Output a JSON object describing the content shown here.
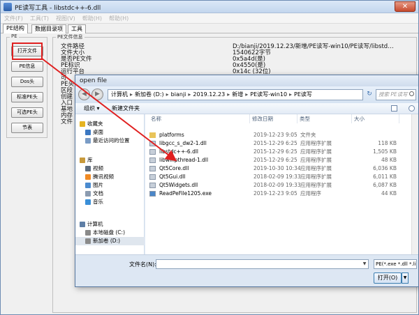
{
  "main_window": {
    "title": "PE读写工具 - libstdc++-6.dll",
    "close_glyph": "✕",
    "menu": [
      "文件(F)",
      "工具(T)",
      "视图(V)",
      "帮助(H)",
      "帮助(H)"
    ],
    "tabs": [
      "PE结构",
      "数据目录项",
      "工具"
    ],
    "pe_group_label": "PE",
    "info_group_label": "PE文件信息",
    "side_buttons": [
      "打开文件",
      "PE信息",
      "Dos头",
      "标准PE头",
      "可选PE头",
      "节表"
    ],
    "info_labels": [
      "文件路径",
      "文件大小",
      "是否PE文件",
      "PE标识",
      "运行平台",
      "可",
      "PE头",
      "区段",
      "创建",
      "入口",
      "基地",
      "内存",
      "文件"
    ],
    "info_values": [
      "D:/bianji/2019.12.23/新增/PE读写-win10/PE读写/libstd…",
      "1540622字节",
      "0x5a4d(是)",
      "0x4550(是)",
      "0x14c (32位)"
    ]
  },
  "dialog": {
    "title": "open file",
    "back_glyph": "◀",
    "forward_glyph": "▶",
    "breadcrumbs": [
      "计算机",
      "新加卷 (D:)",
      "bianji",
      "2019.12.23",
      "新增",
      "PE读写-win10",
      "PE读写"
    ],
    "refresh_glyph": "↻",
    "search_placeholder": "搜索 PE读写",
    "toolbar": {
      "organize": "组织 ▾",
      "new_folder": "新建文件夹"
    },
    "nav_items": [
      {
        "label": "收藏夹",
        "icon": "star-icon",
        "color": "#e6b422"
      },
      {
        "label": "桌面",
        "icon": "desktop-icon",
        "color": "#3b78c2"
      },
      {
        "label": "最近访问的位置",
        "icon": "recent-icon",
        "color": "#7a9cc6"
      },
      {
        "label": "库",
        "icon": "library-icon",
        "color": "#c89a3c"
      },
      {
        "label": "视频",
        "icon": "video-icon",
        "color": "#5c6c80"
      },
      {
        "label": "腾讯视频",
        "icon": "tencent-video-icon",
        "color": "#f08a24"
      },
      {
        "label": "图片",
        "icon": "picture-icon",
        "color": "#4b8bcf"
      },
      {
        "label": "文档",
        "icon": "document-icon",
        "color": "#8b9bb0"
      },
      {
        "label": "音乐",
        "icon": "music-icon",
        "color": "#3a8fd8"
      },
      {
        "label": "计算机",
        "icon": "computer-icon",
        "color": "#5f7fa6"
      },
      {
        "label": "本地磁盘 (C:)",
        "icon": "disk-icon",
        "color": "#8a8a8a"
      },
      {
        "label": "新加卷 (D:)",
        "icon": "disk-icon",
        "color": "#8a8a8a"
      }
    ],
    "columns": [
      "名称",
      "修改日期",
      "类型",
      "大小"
    ],
    "files": [
      {
        "name": "platforms",
        "date": "2019-12-23 9:05",
        "type": "文件夹",
        "size": "",
        "kind": "folder"
      },
      {
        "name": "libgcc_s_dw2-1.dll",
        "date": "2015-12-29 6:25",
        "type": "应用程序扩展",
        "size": "118 KB",
        "kind": "dll"
      },
      {
        "name": "libstdc++-6.dll",
        "date": "2015-12-29 6:25",
        "type": "应用程序扩展",
        "size": "1,505 KB",
        "kind": "dll"
      },
      {
        "name": "libwinpthread-1.dll",
        "date": "2015-12-29 6:25",
        "type": "应用程序扩展",
        "size": "48 KB",
        "kind": "dll"
      },
      {
        "name": "Qt5Core.dll",
        "date": "2019-10-30 10:34",
        "type": "应用程序扩展",
        "size": "6,036 KB",
        "kind": "dll"
      },
      {
        "name": "Qt5Gui.dll",
        "date": "2018-02-09 19:33",
        "type": "应用程序扩展",
        "size": "6,011 KB",
        "kind": "dll"
      },
      {
        "name": "Qt5Widgets.dll",
        "date": "2018-02-09 19:33",
        "type": "应用程序扩展",
        "size": "6,087 KB",
        "kind": "dll"
      },
      {
        "name": "ReadPeFile1205.exe",
        "date": "2019-12-23 9:05",
        "type": "应用程序",
        "size": "44 KB",
        "kind": "exe"
      }
    ],
    "filename_label": "文件名(N):",
    "filename_value": "",
    "filetype_value": "PE(*.exe *.dll *.lib)",
    "open_label": "打开(O)",
    "dropdown_glyph": "▼"
  },
  "colors": {
    "annotation_red": "#e02020",
    "folder": "#e9c45a",
    "dll": "#c7cfd9",
    "exe": "#4a86c8"
  }
}
